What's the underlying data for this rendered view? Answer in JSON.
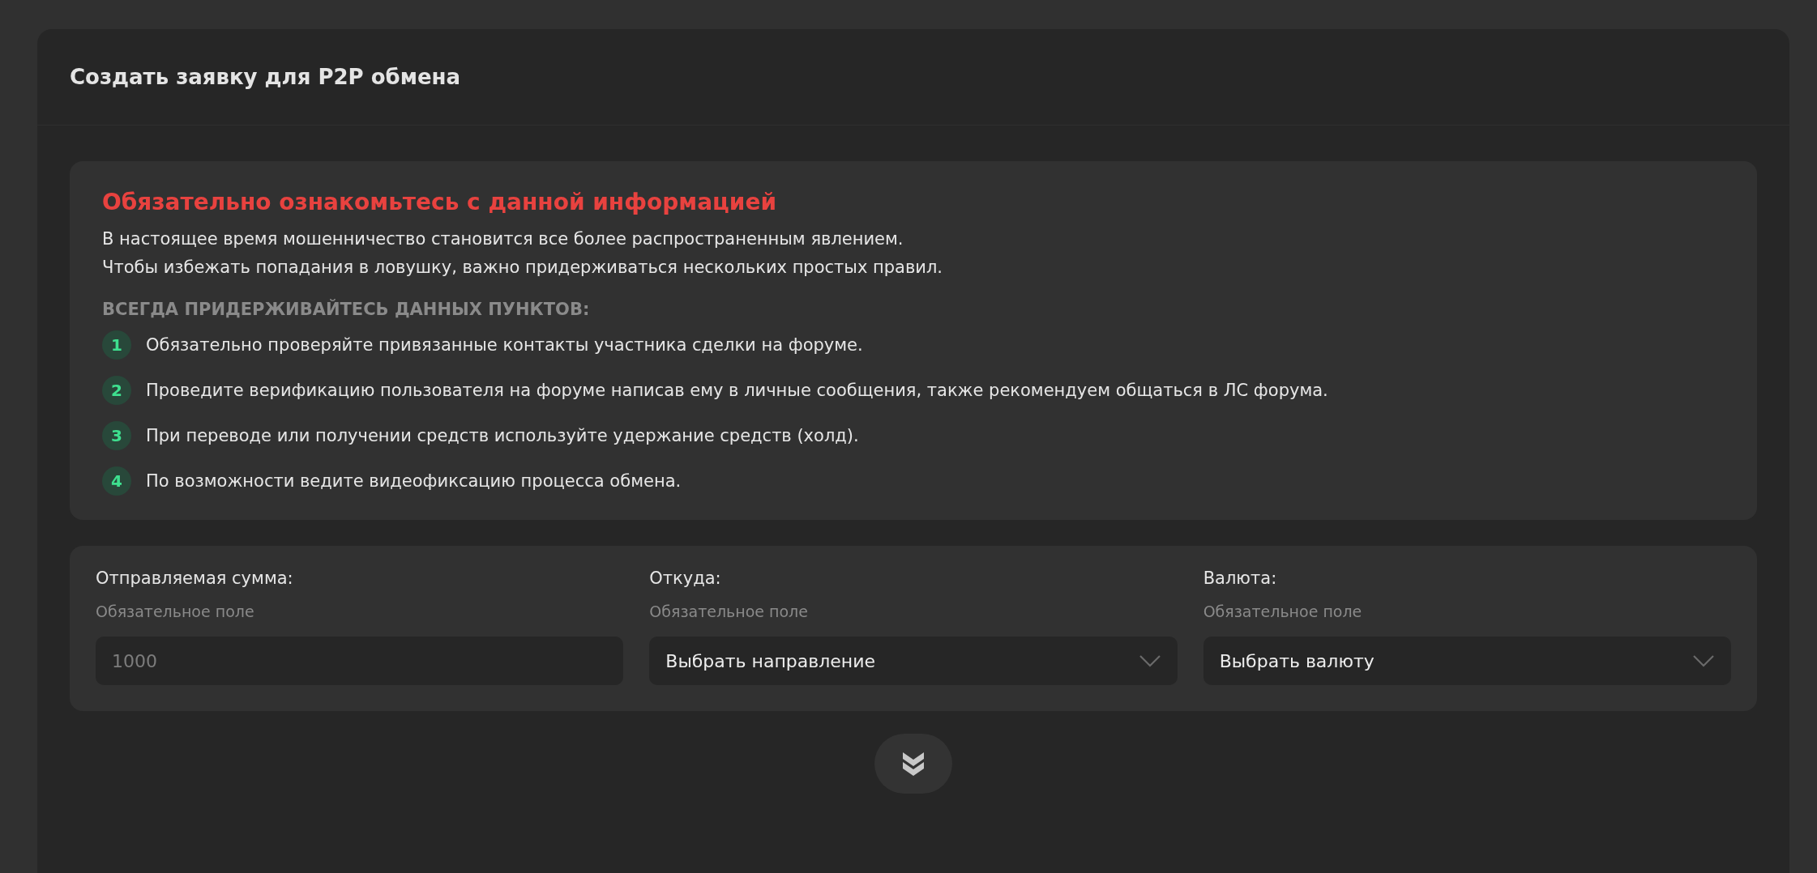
{
  "panel": {
    "title": "Создать заявку для P2P обмена"
  },
  "notice": {
    "heading": "Обязательно ознакомьтесь с данной информацией",
    "lines": [
      "В настоящее время мошенничество становится все более распространенным явлением.",
      "Чтобы избежать попадания в ловушку, важно придерживаться нескольких простых правил."
    ],
    "rules_heading": "ВСЕГДА ПРИДЕРЖИВАЙТЕСЬ ДАННЫХ ПУНКТОВ:",
    "rules": [
      {
        "number": "1",
        "text": "Обязательно проверяйте привязанные контакты участника сделки на форуме."
      },
      {
        "number": "2",
        "text": "Проведите верификацию пользователя на форуме написав ему в личные сообщения, также рекомендуем общаться в ЛС форума."
      },
      {
        "number": "3",
        "text": "При переводе или получении средств используйте удержание средств (холд)."
      },
      {
        "number": "4",
        "text": "По возможности ведите видеофиксацию процесса обмена."
      }
    ]
  },
  "form": {
    "fields": [
      {
        "kind": "input",
        "label": "Отправляемая сумма:",
        "hint": "Обязательное поле",
        "placeholder": "1000"
      },
      {
        "kind": "select",
        "label": "Откуда:",
        "hint": "Обязательное поле",
        "value": "Выбрать направление"
      },
      {
        "kind": "select",
        "label": "Валюта:",
        "hint": "Обязательное поле",
        "value": "Выбрать валюту"
      }
    ]
  }
}
